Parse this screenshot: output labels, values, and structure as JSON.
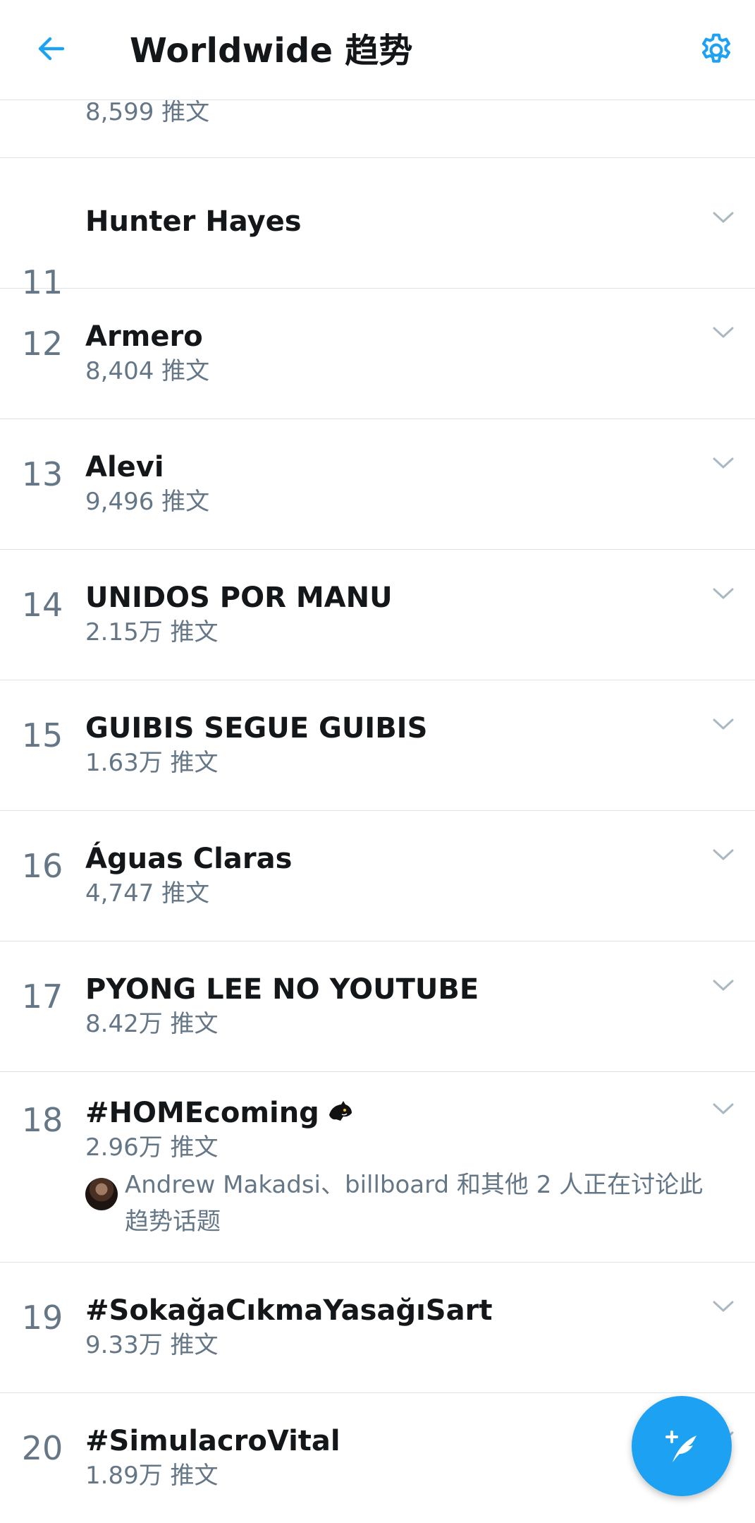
{
  "header": {
    "title": "Worldwide 趋势",
    "back_icon": "arrow-left-icon",
    "settings_icon": "gear-icon",
    "accent": "#1da1f2"
  },
  "partial_item": {
    "meta": "8,599 推文"
  },
  "trends": [
    {
      "rank": "11",
      "name": "Hunter Hayes",
      "meta": ""
    },
    {
      "rank": "12",
      "name": "Armero",
      "meta": "8,404 推文"
    },
    {
      "rank": "13",
      "name": "Alevi",
      "meta": "9,496 推文"
    },
    {
      "rank": "14",
      "name": "UNIDOS POR MANU",
      "meta": "2.15万 推文"
    },
    {
      "rank": "15",
      "name": "GUIBIS SEGUE GUIBIS",
      "meta": "1.63万 推文"
    },
    {
      "rank": "16",
      "name": "Águas Claras",
      "meta": "4,747 推文"
    },
    {
      "rank": "17",
      "name": "PYONG LEE NO YOUTUBE",
      "meta": "8.42万 推文"
    },
    {
      "rank": "18",
      "name": "#HOMEcoming",
      "meta": "2.96万 推文",
      "context": "Andrew Makadsi、billboard 和其他 2 人正在讨论此趋势话题"
    },
    {
      "rank": "19",
      "name": "#SokağaCıkmaYasağıSart",
      "meta": "9.33万 推文"
    },
    {
      "rank": "20",
      "name": "#SimulacroVital",
      "meta": "1.89万 推文"
    }
  ],
  "fab": {
    "icon": "compose-tweet-icon"
  }
}
